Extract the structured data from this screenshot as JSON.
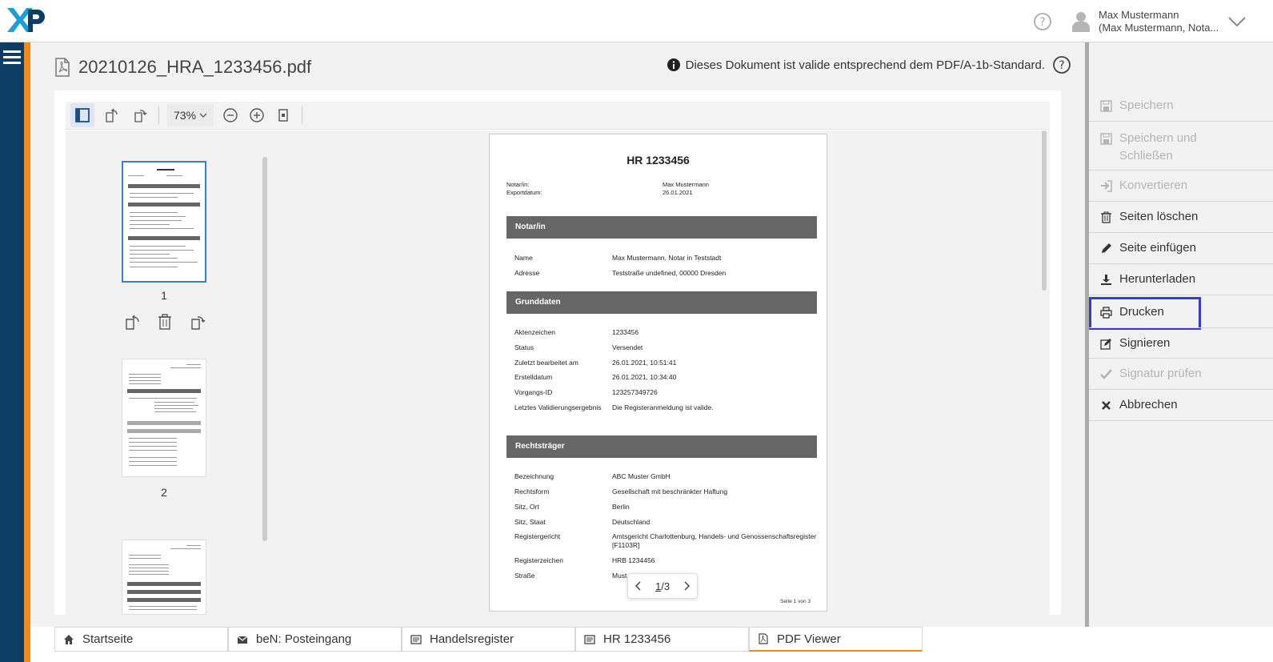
{
  "header": {
    "logo_text": "XP",
    "user_name": "Max Mustermann",
    "user_detail": "(Max Mustermann, Nota..."
  },
  "document": {
    "title": "20210126_HRA_1233456.pdf",
    "validity_message": "Dieses Dokument ist valide entsprechend dem PDF/A-1b-Standard."
  },
  "toolbar": {
    "zoom": "73%"
  },
  "thumbnails": [
    {
      "label": "1"
    },
    {
      "label": "2"
    },
    {
      "label": ""
    }
  ],
  "page": {
    "title": "HR 1233456",
    "meta": [
      {
        "k": "Notar/in:",
        "v": "Max Mustermann"
      },
      {
        "k": "Exportdatum:",
        "v": "26.01.2021"
      }
    ],
    "sections": [
      {
        "title": "Notar/in",
        "rows": [
          {
            "k": "Name",
            "v": "Max Mustermann, Notar in Teststadt"
          },
          {
            "k": "Adresse",
            "v": "Teststraße undefined, 00000 Dresden"
          }
        ]
      },
      {
        "title": "Grunddaten",
        "rows": [
          {
            "k": "Aktenzeichen",
            "v": "1233456"
          },
          {
            "k": "Status",
            "v": "Versendet"
          },
          {
            "k": "Zuletzt bearbeitet am",
            "v": "26.01.2021, 10:51:41"
          },
          {
            "k": "Erstelldatum",
            "v": "26.01.2021, 10:34:40"
          },
          {
            "k": "Vorgangs-ID",
            "v": "123257349726"
          },
          {
            "k": "Letztes Validierungsergebnis",
            "v": "Die Registeranmeldung ist valide."
          }
        ]
      },
      {
        "title": "Rechtsträger",
        "rows": [
          {
            "k": "Bezeichnung",
            "v": "ABC Muster GmbH"
          },
          {
            "k": "Rechtsform",
            "v": "Gesellschaft mit beschränkter Haftung"
          },
          {
            "k": "Sitz, Ort",
            "v": "Berlin"
          },
          {
            "k": "Sitz, Staat",
            "v": "Deutschland"
          },
          {
            "k": "Registergericht",
            "v": "Amtsgericht Charlottenburg, Handels- und Genossenschaftsregister [F1103R]"
          },
          {
            "k": "Registerzeichen",
            "v": "HRB 1234456"
          },
          {
            "k": "Straße",
            "v": "Must"
          }
        ]
      }
    ],
    "footer": "Seite 1 von 3"
  },
  "pager": {
    "current": "1",
    "separator": "/",
    "total": "3"
  },
  "actions": [
    {
      "label": "Speichern",
      "disabled": true,
      "icon": "save-icon"
    },
    {
      "label": "Speichern und Schließen",
      "disabled": true,
      "icon": "save-close-icon"
    },
    {
      "label": "Konvertieren",
      "disabled": true,
      "icon": "convert-icon"
    },
    {
      "label": "Seiten löschen",
      "disabled": false,
      "icon": "trash-icon"
    },
    {
      "label": "Seite einfügen",
      "disabled": false,
      "icon": "pencil-icon"
    },
    {
      "label": "Herunterladen",
      "disabled": false,
      "icon": "download-icon"
    },
    {
      "label": "Drucken",
      "disabled": false,
      "icon": "print-icon"
    },
    {
      "label": "Signieren",
      "disabled": false,
      "icon": "sign-icon"
    },
    {
      "label": "Signatur prüfen",
      "disabled": true,
      "icon": "check-icon"
    },
    {
      "label": "Abbrechen",
      "disabled": false,
      "icon": "close-icon"
    }
  ],
  "tabs": [
    {
      "label": "Startseite",
      "icon": "home-icon"
    },
    {
      "label": "beN: Posteingang",
      "icon": "mail-icon"
    },
    {
      "label": "Handelsregister",
      "icon": "register-icon"
    },
    {
      "label": "HR 1233456",
      "icon": "register-icon"
    },
    {
      "label": "PDF Viewer",
      "icon": "pdf-icon"
    }
  ],
  "colors": {
    "nav": "#0d3d63",
    "accent": "#ef8a1f",
    "focus": "#3a3ccf",
    "selection": "#3a7fd5"
  }
}
